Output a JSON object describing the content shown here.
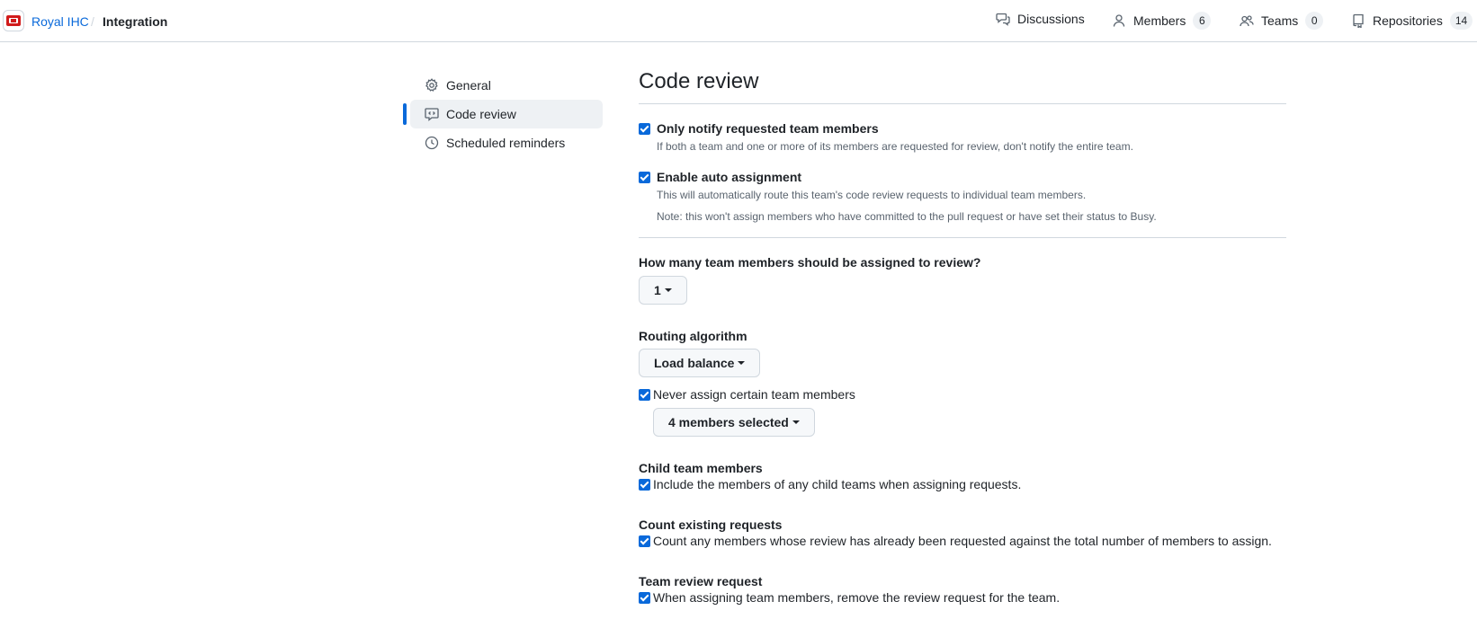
{
  "header": {
    "org": "Royal IHC",
    "separator": "/",
    "team": "Integration",
    "nav": [
      {
        "label": "Discussions",
        "count": null
      },
      {
        "label": "Members",
        "count": "6"
      },
      {
        "label": "Teams",
        "count": "0"
      },
      {
        "label": "Repositories",
        "count": "14"
      }
    ]
  },
  "sidebar": {
    "items": [
      {
        "label": "General",
        "icon": "gear-icon",
        "active": false
      },
      {
        "label": "Code review",
        "icon": "code-review-icon",
        "active": true
      },
      {
        "label": "Scheduled reminders",
        "icon": "clock-icon",
        "active": false
      }
    ]
  },
  "main": {
    "title": "Code review",
    "notify": {
      "label": "Only notify requested team members",
      "checked": true,
      "note": "If both a team and one or more of its members are requested for review, don't notify the entire team."
    },
    "auto_assign": {
      "label": "Enable auto assignment",
      "checked": true,
      "note1": "This will automatically route this team's code review requests to individual team members.",
      "note2": "Note: this won't assign members who have committed to the pull request or have set their status to Busy."
    },
    "how_many": {
      "heading": "How many team members should be assigned to review?",
      "value": "1"
    },
    "routing": {
      "heading": "Routing algorithm",
      "value": "Load balance"
    },
    "never_assign": {
      "label": "Never assign certain team members",
      "checked": true,
      "button": "4 members selected"
    },
    "child_team": {
      "heading": "Child team members",
      "label": "Include the members of any child teams when assigning requests.",
      "checked": true
    },
    "count_existing": {
      "heading": "Count existing requests",
      "label": "Count any members whose review has already been requested against the total number of members to assign.",
      "checked": true
    },
    "team_review": {
      "heading": "Team review request",
      "label": "When assigning team members, remove the review request for the team.",
      "checked": true
    }
  },
  "colors": {
    "accent": "#0969da",
    "border": "#d0d7de",
    "muted": "#59636e",
    "logo_red": "#d11b1b"
  }
}
